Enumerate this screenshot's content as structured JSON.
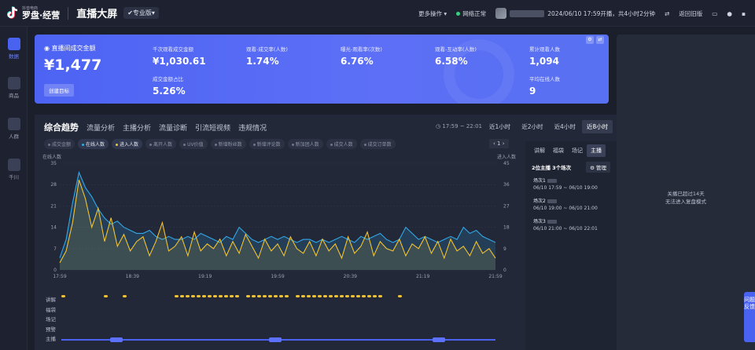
{
  "topbar": {
    "logo_small": "抖音电商",
    "logo_main": "罗盘·经营",
    "title": "直播大屏",
    "edition": "专业版",
    "more_ops": "更多操作",
    "network": "网络正常",
    "live_time": "2024/06/10 17:59开播，共4小时2分钟",
    "back_old": "返回旧版"
  },
  "sidebar": {
    "items": [
      {
        "label": "数据",
        "active": true
      },
      {
        "label": "商品",
        "active": false
      },
      {
        "label": "人群",
        "active": false
      },
      {
        "label": "千川",
        "active": false
      }
    ]
  },
  "banner": {
    "main_label": "直播间成交金额",
    "main_value": "¥1,477",
    "create_target": "创建目标",
    "metrics": [
      {
        "label": "千次观看成交金额",
        "value": "¥1,030.61"
      },
      {
        "label": "观看-成交率(人数)",
        "value": "1.74%"
      },
      {
        "label": "曝光-观看率(次数)",
        "value": "6.76%"
      },
      {
        "label": "观看-互动率(人数)",
        "value": "6.58%"
      },
      {
        "label": "累计观看人数",
        "value": "1,094"
      },
      {
        "label": "成交金额占比",
        "value": "5.26%"
      },
      {
        "label": "平均在线人数",
        "value": "9"
      }
    ]
  },
  "right_panel": {
    "line1": "关播已超过14天",
    "line2": "无法进入复盘模式"
  },
  "feedback": "问题反馈",
  "trend": {
    "tabs": [
      "综合趋势",
      "流量分析",
      "主播分析",
      "流量诊断",
      "引流短视频",
      "违规情况"
    ],
    "time_range": "17:59 ~ 22:01",
    "periods": [
      "近1小时",
      "近2小时",
      "近4小时",
      "近8小时"
    ],
    "active_period": 3,
    "legend": [
      {
        "label": "成交金额",
        "on": false,
        "color": "#6e768a"
      },
      {
        "label": "在线人数",
        "on": true,
        "color": "#31a8e8"
      },
      {
        "label": "进入人数",
        "on": true,
        "color": "#f2c230"
      },
      {
        "label": "离开人数",
        "on": false,
        "color": "#6e768a"
      },
      {
        "label": "UV价值",
        "on": false,
        "color": "#6e768a"
      },
      {
        "label": "新增粉丝数",
        "on": false,
        "color": "#6e768a"
      },
      {
        "label": "新增评论数",
        "on": false,
        "color": "#6e768a"
      },
      {
        "label": "新加团人数",
        "on": false,
        "color": "#6e768a"
      },
      {
        "label": "成交人数",
        "on": false,
        "color": "#6e768a"
      },
      {
        "label": "成交订单数",
        "on": false,
        "color": "#6e768a"
      }
    ],
    "pager": "1",
    "lanes": [
      "讲解",
      "福袋",
      "场记",
      "预警",
      "主播"
    ],
    "side_tabs": [
      "讲解",
      "福袋",
      "场记",
      "主播"
    ],
    "side_active": 3,
    "anchors_count": "2位主播",
    "sessions_count": "3个场次",
    "manage": "管理",
    "sessions": [
      {
        "title": "场次1",
        "range": "06/10 17:59 ~ 06/10 19:00"
      },
      {
        "title": "场次2",
        "range": "06/10 19:00 ~ 06/10 21:00"
      },
      {
        "title": "场次3",
        "range": "06/10 21:00 ~ 06/10 22:01"
      }
    ]
  },
  "chart_data": {
    "type": "line",
    "ylabel_left": "在线人数",
    "ylabel_right": "进入人数",
    "y_left_ticks": [
      0,
      7,
      14,
      21,
      28,
      35
    ],
    "y_right_ticks": [
      0,
      9,
      18,
      27,
      36,
      45
    ],
    "x_ticks": [
      "17:59",
      "18:39",
      "19:19",
      "19:59",
      "20:39",
      "21:19",
      "21:59"
    ],
    "series": [
      {
        "name": "在线人数",
        "color": "#31a8e8",
        "axis": "left",
        "values": [
          4,
          10,
          22,
          32,
          27,
          24,
          20,
          17,
          15,
          16,
          14,
          13,
          12,
          12,
          13,
          11,
          10,
          11,
          10,
          10,
          11,
          10,
          12,
          11,
          10,
          9,
          11,
          10,
          14,
          12,
          10,
          9,
          10,
          11,
          10,
          11,
          10,
          9,
          10,
          10,
          9,
          10,
          9,
          10,
          11,
          10,
          9,
          11,
          10,
          11,
          12,
          10,
          9,
          10,
          14,
          12,
          10,
          11,
          10,
          9,
          10,
          11,
          10,
          14,
          12,
          13,
          11,
          10,
          9
        ]
      },
      {
        "name": "进入人数",
        "color": "#f2c230",
        "axis": "right",
        "values": [
          3,
          8,
          20,
          38,
          30,
          18,
          26,
          12,
          22,
          10,
          15,
          8,
          12,
          14,
          6,
          12,
          20,
          8,
          10,
          14,
          6,
          16,
          8,
          11,
          9,
          13,
          6,
          12,
          7,
          15,
          10,
          5,
          13,
          8,
          11,
          6,
          14,
          9,
          7,
          12,
          6,
          13,
          8,
          11,
          5,
          14,
          7,
          10,
          16,
          6,
          12,
          9,
          8,
          13,
          6,
          11,
          9,
          14,
          7,
          12,
          5,
          13,
          8,
          10,
          6,
          12,
          7,
          9,
          5
        ]
      }
    ]
  }
}
